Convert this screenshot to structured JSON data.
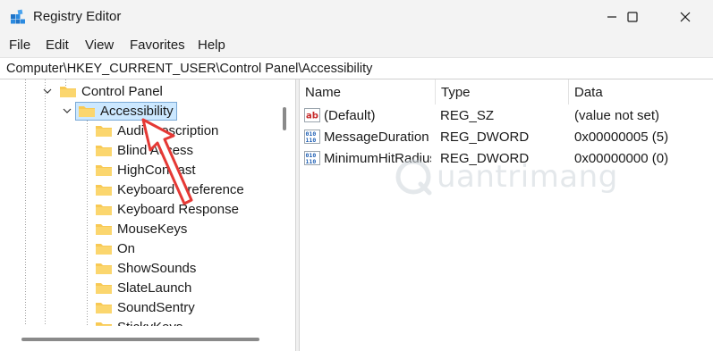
{
  "window": {
    "title": "Registry Editor"
  },
  "menu": {
    "items": [
      {
        "label": "File"
      },
      {
        "label": "Edit"
      },
      {
        "label": "View"
      },
      {
        "label": "Favorites"
      },
      {
        "label": "Help"
      }
    ]
  },
  "address": {
    "path": "Computer\\HKEY_CURRENT_USER\\Control Panel\\Accessibility"
  },
  "tree": {
    "parent": "Control Panel",
    "selected": "Accessibility",
    "children": [
      {
        "label": "AudioDescription"
      },
      {
        "label": "Blind Access"
      },
      {
        "label": "HighContrast"
      },
      {
        "label": "Keyboard Preference"
      },
      {
        "label": "Keyboard Response"
      },
      {
        "label": "MouseKeys"
      },
      {
        "label": "On"
      },
      {
        "label": "ShowSounds"
      },
      {
        "label": "SlateLaunch"
      },
      {
        "label": "SoundSentry"
      },
      {
        "label": "StickyKeys"
      }
    ]
  },
  "list": {
    "columns": {
      "name": "Name",
      "type": "Type",
      "data": "Data"
    },
    "rows": [
      {
        "name": "(Default)",
        "type": "REG_SZ",
        "data": "(value not set)",
        "icon": "string-value-icon"
      },
      {
        "name": "MessageDuration",
        "type": "REG_DWORD",
        "data": "0x00000005 (5)",
        "icon": "binary-value-icon"
      },
      {
        "name": "MinimumHitRadius",
        "type": "REG_DWORD",
        "data": "0x00000000 (0)",
        "icon": "binary-value-icon"
      }
    ]
  },
  "watermark": {
    "text": "uantrimang"
  },
  "colors": {
    "selection": "#cce8ff",
    "folder": "#f8c954",
    "arrow": "#e53935"
  }
}
